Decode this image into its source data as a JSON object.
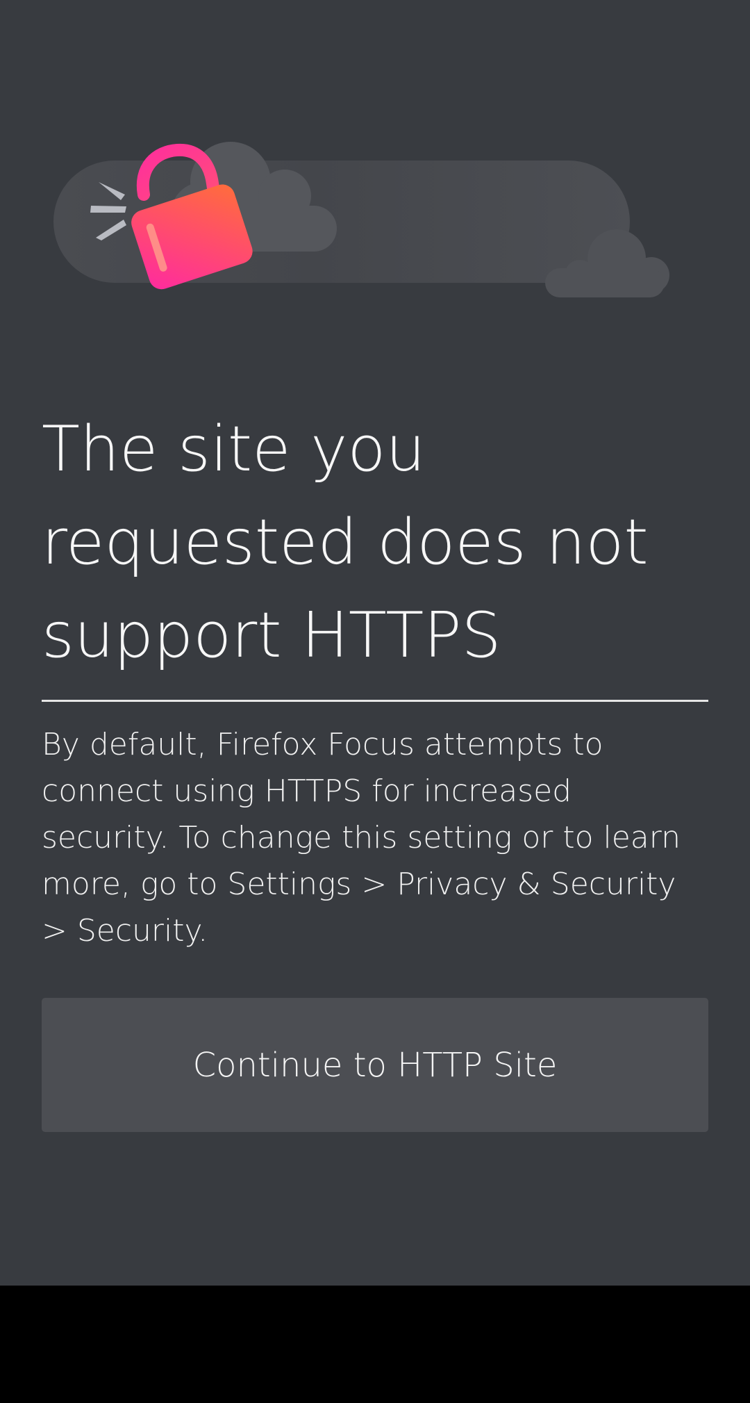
{
  "error_page": {
    "title": "The site you requested does not support HTTPS",
    "description": "By default, Firefox Focus attempts to connect using HTTPS for increased security. To change this setting or to learn more, go to Settings > Privacy & Security > Security.",
    "continue_label": "Continue to HTTP Site",
    "illustration_icon": "unlocked-padlock-icon"
  },
  "colors": {
    "background": "#383b40",
    "button": "#4c4e53",
    "text": "#f7f7f7",
    "lock_gradient_start": "#ff3da8",
    "lock_gradient_end": "#ff6b3d"
  }
}
